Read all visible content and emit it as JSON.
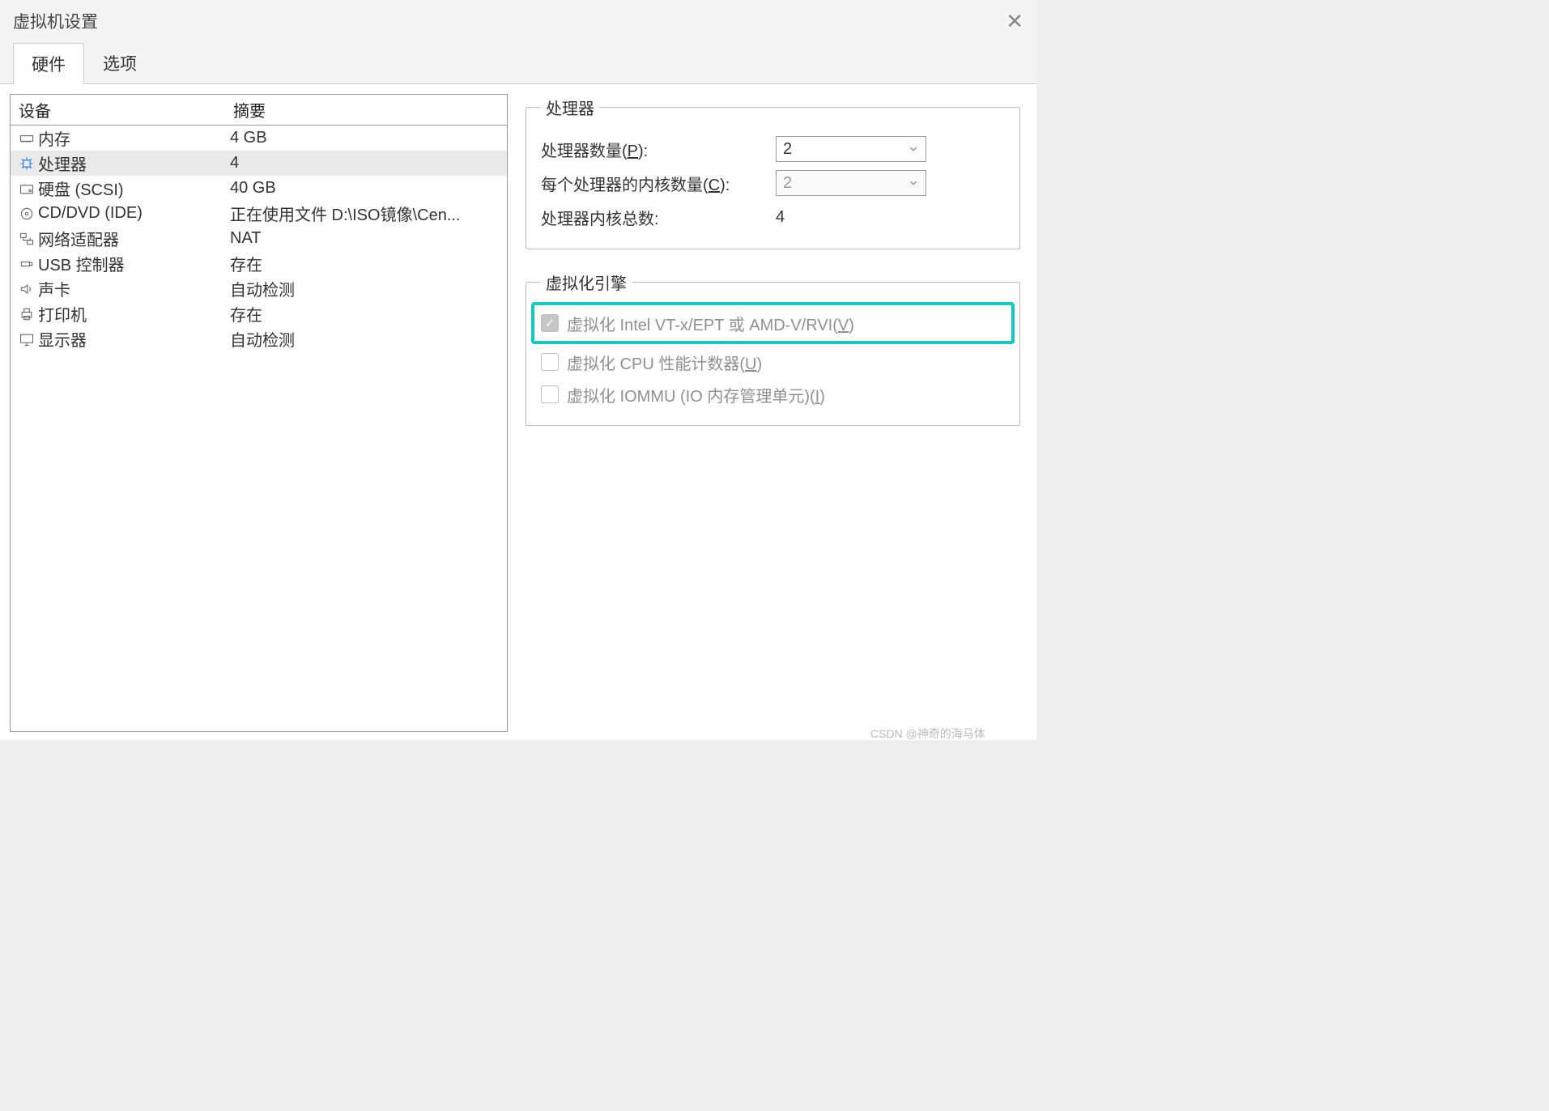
{
  "window": {
    "title": "虚拟机设置"
  },
  "tabs": {
    "hardware": "硬件",
    "options": "选项"
  },
  "deviceHeader": {
    "device": "设备",
    "summary": "摘要"
  },
  "devices": [
    {
      "icon": "memory",
      "name": "内存",
      "summary": "4 GB"
    },
    {
      "icon": "cpu",
      "name": "处理器",
      "summary": "4"
    },
    {
      "icon": "disk",
      "name": "硬盘 (SCSI)",
      "summary": "40 GB"
    },
    {
      "icon": "disc",
      "name": "CD/DVD (IDE)",
      "summary": "正在使用文件 D:\\ISO镜像\\Cen..."
    },
    {
      "icon": "net",
      "name": "网络适配器",
      "summary": "NAT"
    },
    {
      "icon": "usb",
      "name": "USB 控制器",
      "summary": "存在"
    },
    {
      "icon": "sound",
      "name": "声卡",
      "summary": "自动检测"
    },
    {
      "icon": "printer",
      "name": "打印机",
      "summary": "存在"
    },
    {
      "icon": "display",
      "name": "显示器",
      "summary": "自动检测"
    }
  ],
  "processorGroup": {
    "legend": "处理器",
    "numProcessorsLabelA": "处理器数量(",
    "numProcessorsKey": "P",
    "numProcessorsLabelB": "):",
    "numProcessorsValue": "2",
    "coresPerLabelA": "每个处理器的内核数量(",
    "coresPerKey": "C",
    "coresPerLabelB": "):",
    "coresPerValue": "2",
    "totalLabel": "处理器内核总数:",
    "totalValue": "4"
  },
  "virtEngine": {
    "legend": "虚拟化引擎",
    "vtA": "虚拟化 Intel VT-x/EPT 或 AMD-V/RVI(",
    "vtKey": "V",
    "vtB": ")",
    "cpuCtrA": "虚拟化 CPU 性能计数器(",
    "cpuCtrKey": "U",
    "cpuCtrB": ")",
    "iommuA": "虚拟化 IOMMU (IO 内存管理单元)(",
    "iommuKey": "I",
    "iommuB": ")"
  },
  "watermark": "CSDN @神奇的海马体"
}
